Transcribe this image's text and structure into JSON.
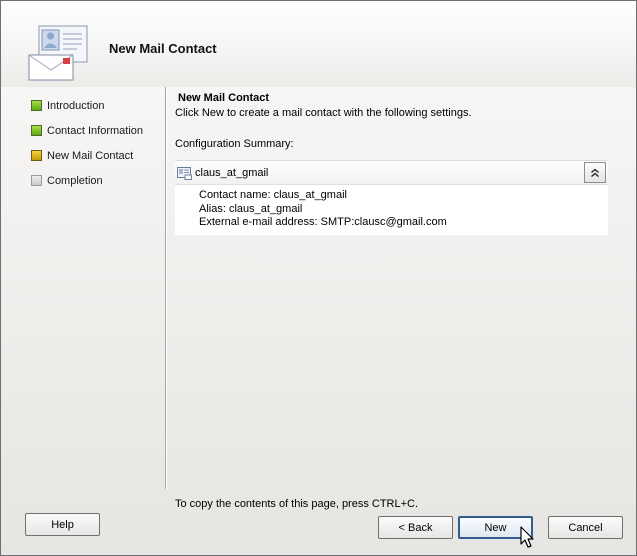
{
  "window": {
    "title": "New Mail Contact"
  },
  "nav": {
    "items": [
      {
        "label": "Introduction",
        "state": "done"
      },
      {
        "label": "Contact Information",
        "state": "done"
      },
      {
        "label": "New Mail Contact",
        "state": "current"
      },
      {
        "label": "Completion",
        "state": "pending"
      }
    ]
  },
  "content": {
    "section_title": "New Mail Contact",
    "description": "Click New to create a mail contact with the following settings.",
    "summary_label": "Configuration Summary:",
    "summary": {
      "name": "claus_at_gmail",
      "lines": [
        "Contact name: claus_at_gmail",
        "Alias: claus_at_gmail",
        "External e-mail address: SMTP:clausc@gmail.com"
      ]
    }
  },
  "footer": {
    "note": "To copy the contents of this page, press CTRL+C.",
    "help_label": "Help",
    "back_label": "< Back",
    "new_label": "New",
    "cancel_label": "Cancel"
  },
  "colors": {
    "done": "#6cb41a",
    "current": "#d9ad14",
    "pending": "#d6d6d6",
    "default_button_border": "#2f5e8e"
  }
}
